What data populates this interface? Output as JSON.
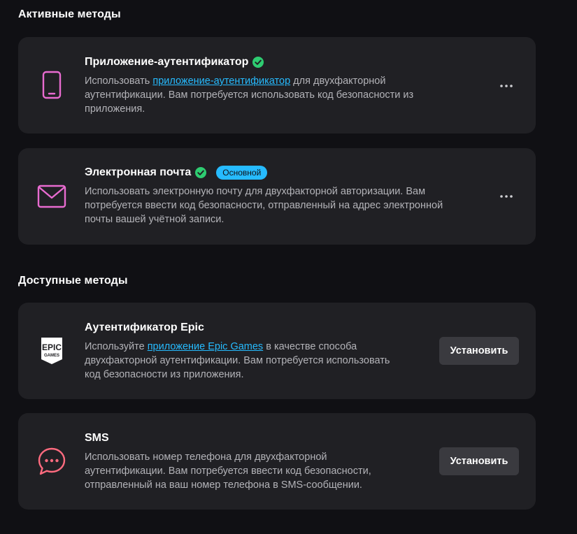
{
  "active_section": {
    "title": "Активные методы"
  },
  "available_section": {
    "title": "Доступные методы"
  },
  "methods_active": [
    {
      "title": "Приложение-аутентификатор",
      "desc_before": "Использовать ",
      "desc_link": "приложение-аутентификатор",
      "desc_after_line1": " для двухфакторной",
      "desc_line2": "аутентификации. Вам потребуется использовать код безопасности из",
      "desc_line3": "приложения.",
      "icon": "smartphone-icon",
      "more_label": "•••"
    },
    {
      "title": "Электронная почта",
      "badge": "Основной",
      "desc_line1": "Использовать электронную почту для двухфакторной авторизации. Вам",
      "desc_line2": "потребуется ввести код безопасности, отправленный на адрес электронной",
      "desc_line3": "почты вашей учётной записи.",
      "icon": "envelope-icon",
      "more_label": "•••"
    }
  ],
  "methods_available": [
    {
      "title": "Аутентификатор Epic",
      "desc_before": "Используйте ",
      "desc_link": "приложение Epic Games",
      "desc_after_line1": " в качестве способа",
      "desc_line2": "двухфакторной аутентификации. Вам потребуется использовать",
      "desc_line3": "код безопасности из приложения.",
      "icon": "epic-games-logo",
      "logo_text_top": "EPIC",
      "logo_text_bottom": "GAMES",
      "button_label": "Установить"
    },
    {
      "title": "SMS",
      "desc_line1": "Использовать номер телефона для двухфакторной",
      "desc_line2": "аутентификации. Вам потребуется ввести код безопасности,",
      "desc_line3": "отправленный на ваш номер телефона в SMS-сообщении.",
      "icon": "chat-bubble-icon",
      "button_label": "Установить"
    }
  ],
  "colors": {
    "background": "#101014",
    "card": "#202024",
    "accent": "#26bbff",
    "success": "#2ecc71",
    "icon_pink": "#e86bd0",
    "icon_sms": "#ff6b7f"
  }
}
